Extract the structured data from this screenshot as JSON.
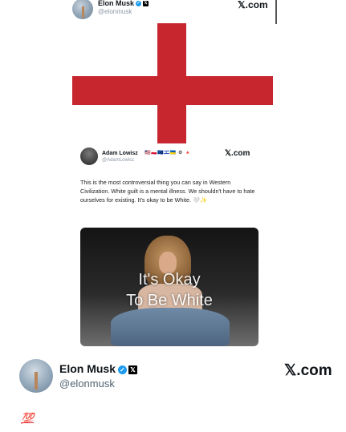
{
  "top_post": {
    "author_name": "Elon Musk",
    "handle": "@elonmusk",
    "site_label": "𝕏.com",
    "verified_icon": "✓",
    "x_icon": "𝕏"
  },
  "image": {
    "cross_color": "#c8262f",
    "embedded_post": {
      "author_name": "Adam Lowisz",
      "flags": "🇺🇸🇵🇱🇪🇺🇮🇱🇺🇦 ⚙ 🔺",
      "handle": "@AdamLowisz",
      "site_label": "𝕏.com",
      "text": "This is the most controversial thing you can say in Western Civilization. White guilt is a mental illness. We shouldn't have to hate ourselves for existing. It's okay to be White. 🤍✨",
      "media_caption_line1": "It's Okay",
      "media_caption_line2": "To Be White"
    }
  },
  "author": {
    "name": "Elon Musk",
    "handle": "@elonmusk",
    "site_label": "𝕏.com",
    "verified_icon": "✓",
    "x_icon": "𝕏"
  },
  "reply_text": "💯"
}
